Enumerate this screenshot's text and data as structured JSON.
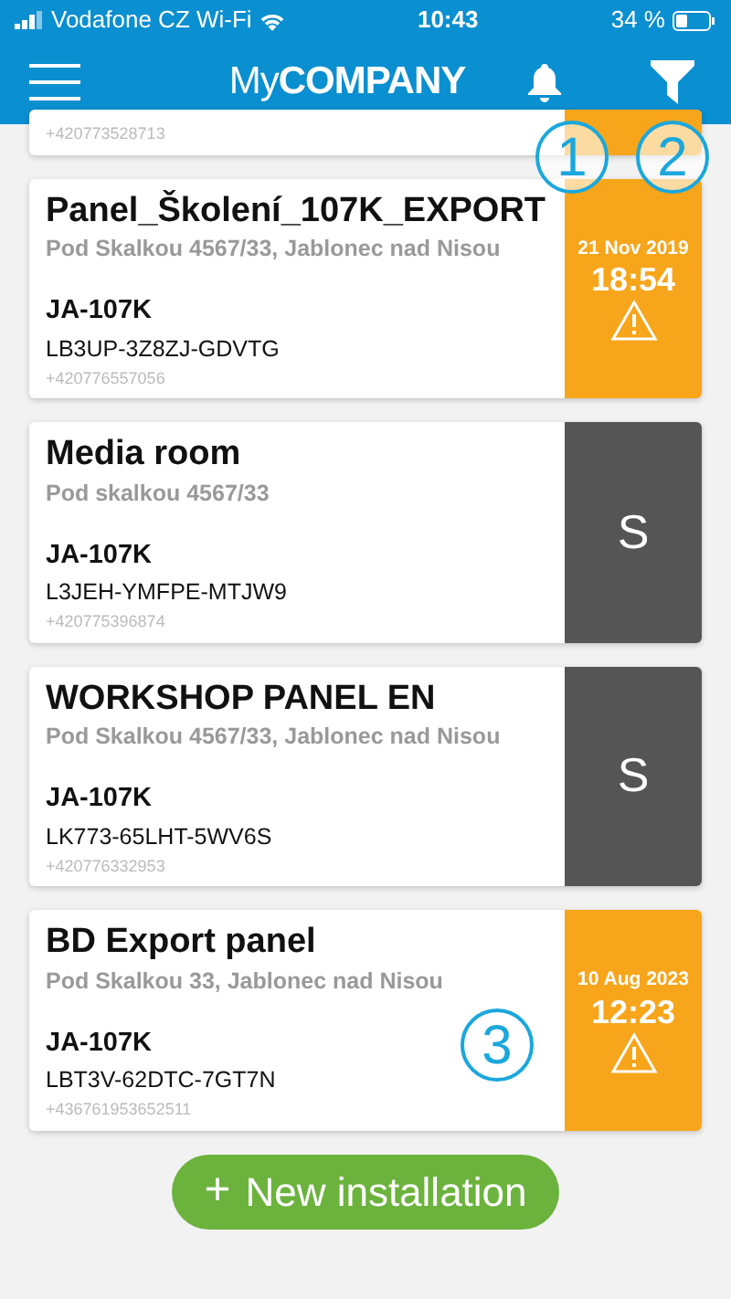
{
  "status_bar": {
    "carrier": "Vodafone CZ Wi-Fi",
    "time": "10:43",
    "battery": "34 %"
  },
  "header": {
    "logo_light": "My",
    "logo_bold": "COMPANY"
  },
  "installations": [
    {
      "partial": true,
      "phone": "+420773528713",
      "status": {
        "kind": "alarm"
      }
    },
    {
      "name": "Panel_Školení_107K_EXPORT",
      "address": "Pod Skalkou 4567/33, Jablonec nad Nisou",
      "model": "JA-107K",
      "serial": "LB3UP-3Z8ZJ-GDVTG",
      "phone": "+420776557056",
      "status": {
        "kind": "alarm",
        "date": "21 Nov 2019",
        "time": "18:54"
      }
    },
    {
      "name": "Media room",
      "address": "Pod skalkou 4567/33",
      "model": "JA-107K",
      "serial": "L3JEH-YMFPE-MTJW9",
      "phone": "+420775396874",
      "status": {
        "kind": "service",
        "letter": "S"
      }
    },
    {
      "name": "WORKSHOP PANEL EN",
      "address": "Pod Skalkou 4567/33, Jablonec nad Nisou",
      "model": "JA-107K",
      "serial": "LK773-65LHT-5WV6S",
      "phone": "+420776332953",
      "status": {
        "kind": "service",
        "letter": "S"
      }
    },
    {
      "name": "BD Export panel",
      "address": "Pod Skalkou 33, Jablonec nad Nisou",
      "model": "JA-107K",
      "serial": "LBT3V-62DTC-7GT7N",
      "phone": "+436761953652511",
      "status": {
        "kind": "alarm",
        "date": "10 Aug 2023",
        "time": "12:23"
      }
    }
  ],
  "new_button": {
    "icon": "+",
    "label": "New installation"
  },
  "callouts": [
    {
      "number": "1"
    },
    {
      "number": "2"
    },
    {
      "number": "3"
    }
  ]
}
